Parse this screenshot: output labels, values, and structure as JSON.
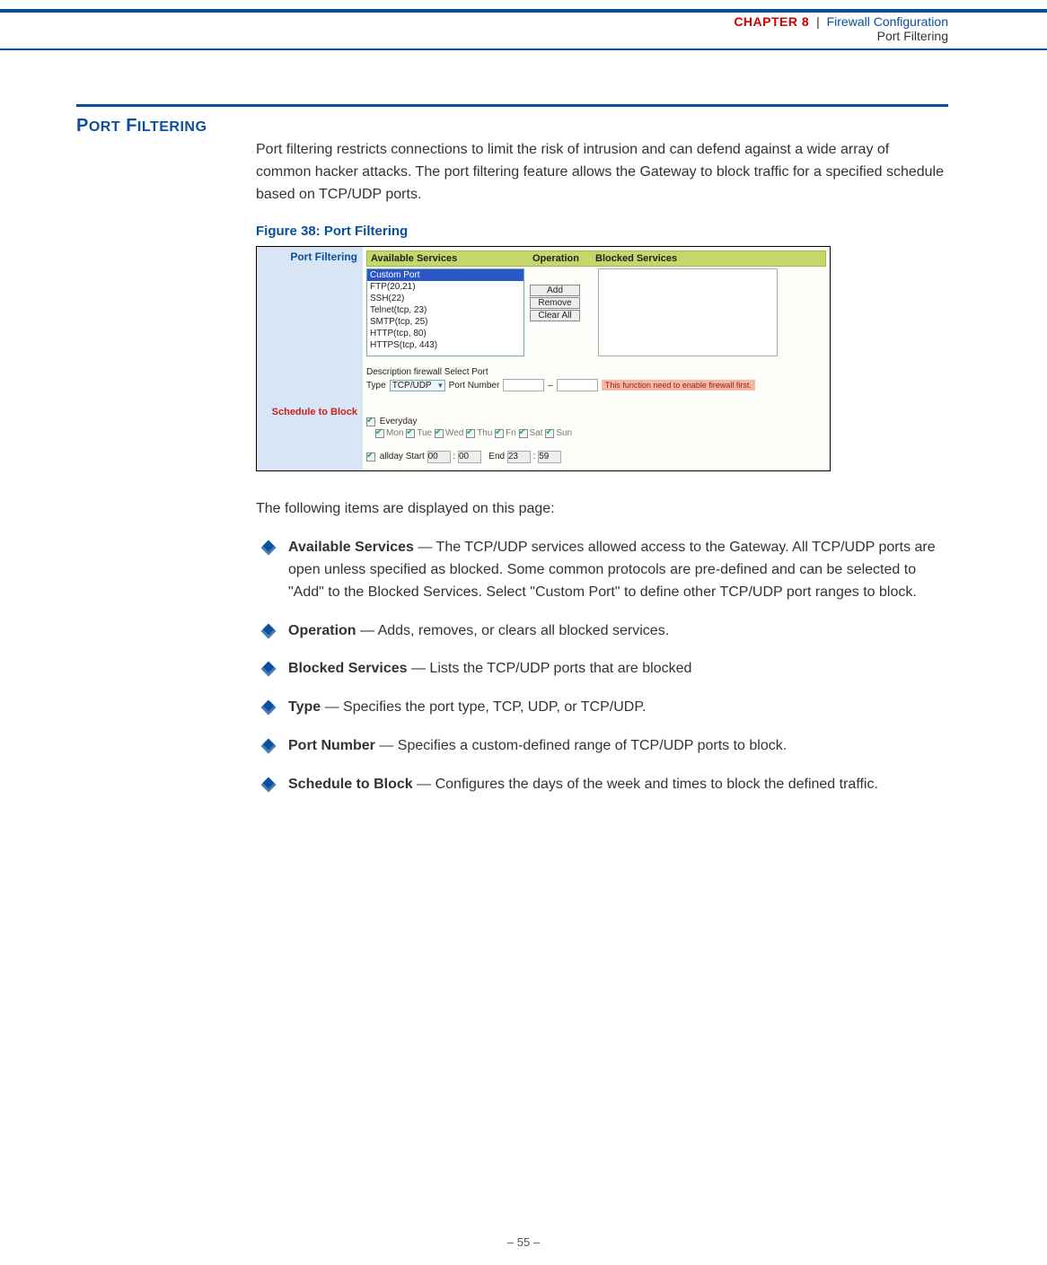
{
  "header": {
    "chapter_label": "CHAPTER 8",
    "pipe": "|",
    "chapter_title": "Firewall Configuration",
    "subsection": "Port Filtering"
  },
  "section": {
    "heading": "PORT FILTERING",
    "intro": "Port filtering restricts connections to limit the risk of intrusion and can defend against a wide array of common hacker attacks. The port filtering feature allows the Gateway to block traffic for a specified schedule based on TCP/UDP ports.",
    "figure_caption": "Figure 38:  Port Filtering",
    "after_figure": "The following items are displayed on this page:"
  },
  "screenshot": {
    "side_title": "Port Filtering",
    "side_schedule": "Schedule to Block",
    "cols": {
      "available": "Available Services",
      "operation": "Operation",
      "blocked": "Blocked Services"
    },
    "services": {
      "selected": "Custom Port",
      "options": [
        "FTP(20,21)",
        "SSH(22)",
        "Telnet(tcp, 23)",
        "SMTP(tcp, 25)",
        "HTTP(tcp, 80)",
        "HTTPS(tcp, 443)"
      ]
    },
    "buttons": {
      "add": "Add",
      "remove": "Remove",
      "clear": "Clear All"
    },
    "desc_label": "Description firewall Select Port",
    "type_label": "Type",
    "type_value": "TCP/UDP",
    "portnum_label": "Port Number",
    "dash": "–",
    "warn": "This function need to enable firewall first.",
    "everyday": "Everyday",
    "days": [
      "Mon",
      "Tue",
      "Wed",
      "Thu",
      "Fri",
      "Sat",
      "Sun"
    ],
    "allday": "allday",
    "start": "Start",
    "end": "End",
    "t1": "00",
    "t2": "00",
    "t3": "23",
    "t4": "59",
    "colon": ":"
  },
  "items": [
    {
      "term": "Available Services",
      "desc": " — The TCP/UDP services allowed access to the Gateway. All TCP/UDP ports are open unless specified as blocked. Some common protocols are pre-defined and can be selected to \"Add\" to the Blocked Services. Select \"Custom Port\" to define other TCP/UDP port ranges to block."
    },
    {
      "term": "Operation",
      "desc": " — Adds, removes, or clears all blocked services."
    },
    {
      "term": "Blocked Services",
      "desc": " — Lists the TCP/UDP ports that are blocked"
    },
    {
      "term": "Type",
      "desc": " — Specifies the port type, TCP, UDP, or TCP/UDP."
    },
    {
      "term": "Port Number",
      "desc": " — Specifies a custom-defined range of TCP/UDP ports to block."
    },
    {
      "term": "Schedule to Block",
      "desc": " — Configures the days of the week and times to block the defined traffic."
    }
  ],
  "footer": {
    "page": "–  55  –"
  }
}
